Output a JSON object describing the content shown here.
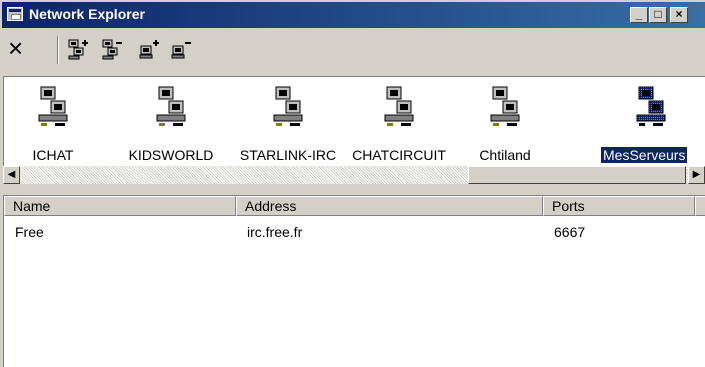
{
  "window": {
    "title": "Network Explorer",
    "controls": {
      "minimize": "_",
      "maximize": "□",
      "close": "×"
    }
  },
  "toolbar": {
    "delete_label": "×",
    "icons": [
      "add-network-icon",
      "remove-network-icon",
      "add-server-icon",
      "remove-server-icon"
    ]
  },
  "networks": [
    {
      "label": "ICHAT",
      "selected": false
    },
    {
      "label": "KIDSWORLD",
      "selected": false
    },
    {
      "label": "STARLINK-IRC",
      "selected": false
    },
    {
      "label": "CHATCIRCUIT",
      "selected": false
    },
    {
      "label": "Chtiland",
      "selected": false
    },
    {
      "label": "MesServeurs",
      "selected": true
    }
  ],
  "scrollbar": {
    "left_arrow": "◀",
    "right_arrow": "▶"
  },
  "table": {
    "columns": [
      "Name",
      "Address",
      "Ports"
    ],
    "rows": [
      {
        "name": "Free",
        "address": "irc.free.fr",
        "ports": "6667"
      }
    ]
  },
  "colors": {
    "titlebar": "#0a246a",
    "selection": "#0a246a",
    "face": "#d4d0c8"
  }
}
